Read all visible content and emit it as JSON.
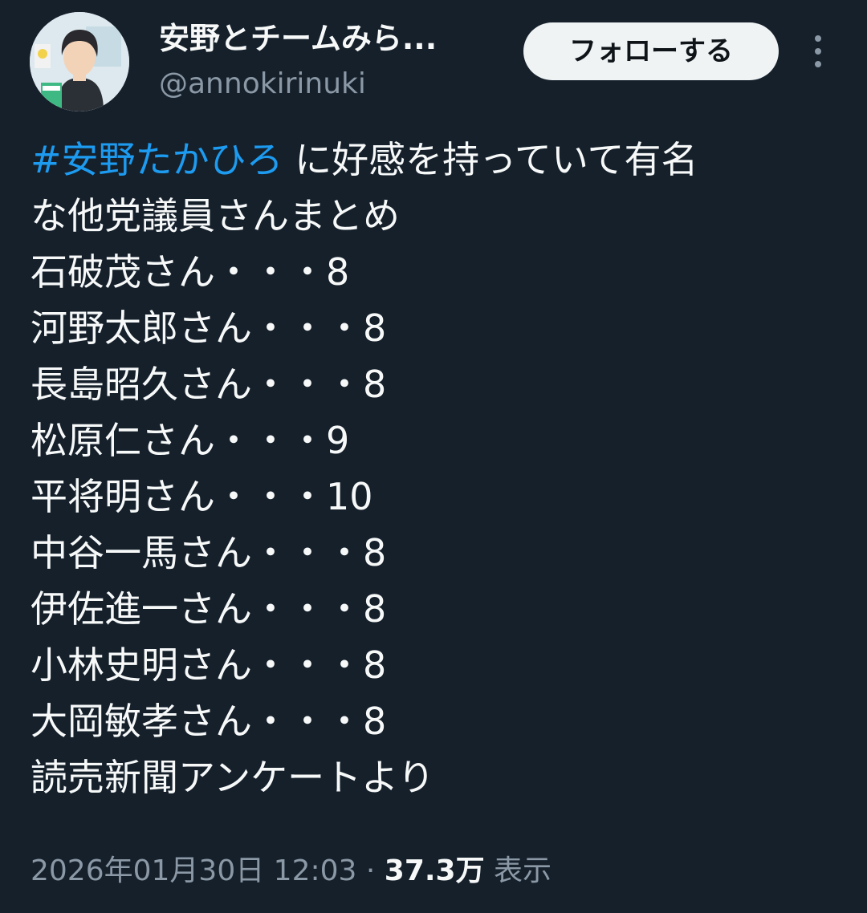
{
  "header": {
    "display_name": "安野とチームみら...",
    "handle": "@annokirinuki",
    "follow_label": "フォローする"
  },
  "tweet": {
    "hashtag": "#安野たかひろ",
    "intro_rest": " に好感を持っていて有名",
    "intro_line2": "な他党議員さんまとめ",
    "items": [
      "石破茂さん・・・8",
      "河野太郎さん・・・8",
      "長島昭久さん・・・8",
      "松原仁さん・・・9",
      "平将明さん・・・10",
      "中谷一馬さん・・・8",
      "伊佐進一さん・・・8",
      "小林史明さん・・・8",
      "大岡敏孝さん・・・8"
    ],
    "source": "読売新聞アンケートより"
  },
  "meta": {
    "timestamp": "2026年01月30日 12:03",
    "separator": " · ",
    "views_count": "37.3万",
    "views_label": " 表示"
  },
  "colors": {
    "background": "#15202b",
    "text": "#f7f9f9",
    "secondary": "#8b98a5",
    "link": "#1d9bf0"
  }
}
